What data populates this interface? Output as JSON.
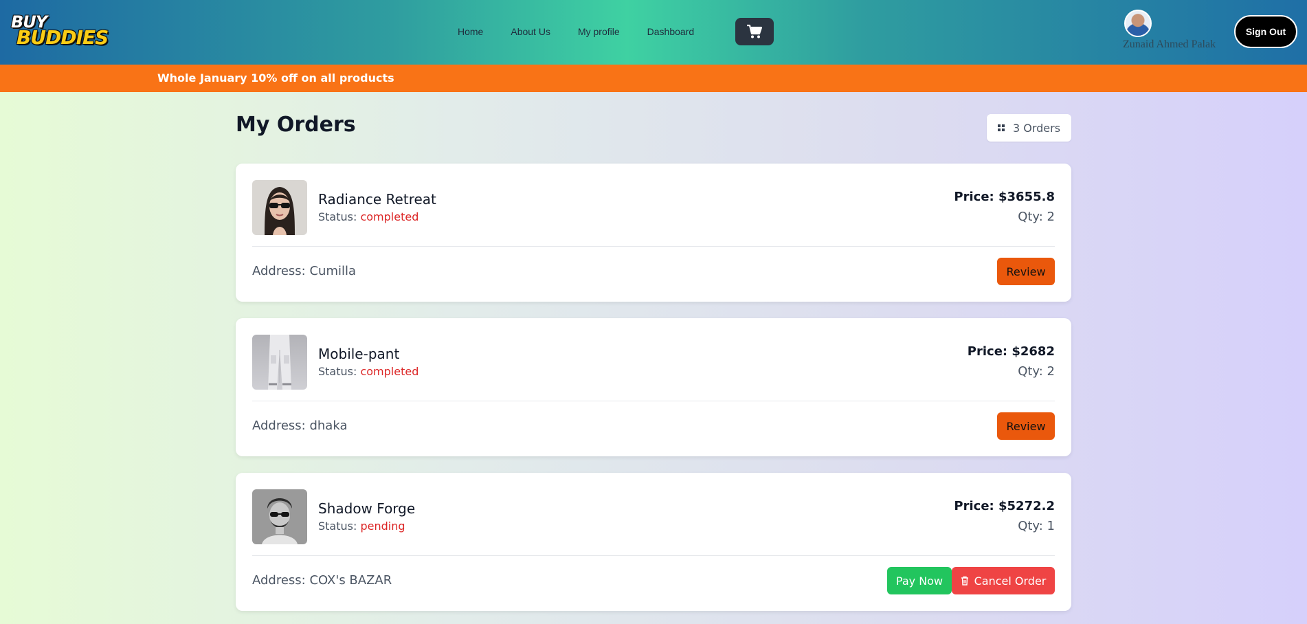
{
  "navbar": {
    "logo_top": "BUY",
    "logo_bottom": "BUDDIES",
    "links": [
      {
        "label": "Home"
      },
      {
        "label": "About Us"
      },
      {
        "label": "My profile"
      },
      {
        "label": "Dashboard"
      }
    ],
    "cart_icon": "cart-icon",
    "user_name": "Zunaid Ahmed Palak",
    "signout_label": "Sign Out"
  },
  "promo": {
    "text": "Whole January 10% off on all products"
  },
  "orders_header": {
    "title": "My Orders",
    "count_label": "3 Orders",
    "count_icon": "grid-icon"
  },
  "orders": [
    {
      "name": "Radiance Retreat",
      "status_label": "Status:",
      "status": "completed",
      "price": "Price: $3655.8",
      "qty": "Qty: 2",
      "address": "Address: Cumilla",
      "action_label": "Review"
    },
    {
      "name": "Mobile-pant",
      "status_label": "Status:",
      "status": "completed",
      "price": "Price: $2682",
      "qty": "Qty: 2",
      "address": "Address: dhaka",
      "action_label": "Review"
    },
    {
      "name": "Shadow Forge",
      "status_label": "Status:",
      "status": "pending",
      "price": "Price: $5272.2",
      "qty": "Qty: 1",
      "address": "Address: COX's BAZAR",
      "pay_label": "Pay Now",
      "cancel_label": "Cancel Order",
      "cancel_icon": "trash-icon"
    }
  ],
  "colors": {
    "promo": "#f97316",
    "review_button": "#ea580c",
    "pay_button": "#22c55e",
    "cancel_button": "#ef4444",
    "status_text": "#dc2626"
  }
}
